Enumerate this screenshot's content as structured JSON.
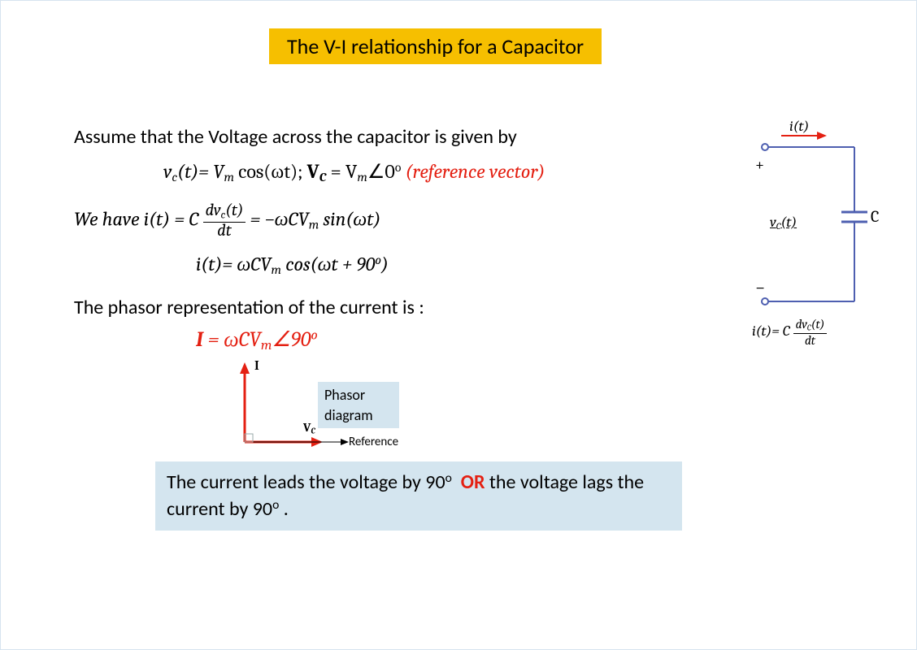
{
  "title": "The V-I relationship for a Capacitor",
  "line1": "Assume that the Voltage across the capacitor is given  by",
  "eq_vc_lhs": "v",
  "eq_vc_sub": "c",
  "eq_vc_t": "(t)= V",
  "eq_vc_m": "m",
  "eq_vc_cos": " cos(ωt);   ",
  "eq_Vc_bold": "V",
  "eq_Vc_bold_sub": "C",
  "eq_Vc_rhs": " = V",
  "eq_Vc_rhs_m": "m",
  "eq_Vc_angle": "∠0",
  "eq_Vc_deg": "o",
  "refvec": "(reference vector)",
  "we_have": "We have   ",
  "eq_it_lhs": "i(t) = C ",
  "eq_it_frac_num": "dv",
  "eq_it_frac_num_sub": "c",
  "eq_it_frac_num_t": "(t)",
  "eq_it_frac_den": "dt",
  "eq_it_mid": " = −ωCV",
  "eq_it_mid_m": "m",
  "eq_it_sin": " sin(ωt)",
  "eq_it2_lhs": "i(t)= ωCV",
  "eq_it2_m": "m",
  "eq_it2_cos": " cos(ωt + 90",
  "eq_it2_deg": "o",
  "eq_it2_close": ")",
  "line_phasor_intro": "The phasor representation of the current is :",
  "phasor_I": "I",
  "phasor_eq": " = ωCV",
  "phasor_m": "m",
  "phasor_angle": "∠90",
  "phasor_deg": "o",
  "pd_caption": "Phasor diagram",
  "pd_I": "I",
  "pd_Vc": "V",
  "pd_Vc_sub": "C",
  "pd_ref": "Reference",
  "conclusion_a": "The current leads the voltage by 90",
  "conclusion_deg": "o",
  "conclusion_or": "OR",
  "conclusion_b": " the voltage lags the current by 90",
  "conclusion_end": "  .",
  "circ_it": "i(t)",
  "circ_plus": "+",
  "circ_vct_v": "v",
  "circ_vct_c": "C",
  "circ_vct_t": "(t)",
  "circ_minus": "−",
  "circ_C": "C",
  "circ_eq_lhs": "i(t)= C ",
  "circ_eq_num_d": "dv",
  "circ_eq_num_c": "C",
  "circ_eq_num_t": "(t)",
  "circ_eq_den": "dt"
}
